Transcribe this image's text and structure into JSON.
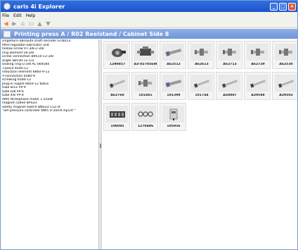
{
  "window": {
    "title": "caris 4i Explorer"
  },
  "menu": {
    "items": [
      "File",
      "Edit",
      "Help"
    ]
  },
  "toolbar": {
    "buttons": [
      "back-icon",
      "forward-icon",
      "home-icon",
      "page-icon",
      "up-icon",
      "down-icon"
    ]
  },
  "header": {
    "title": "Printing press A / R02 Reelstand / Cabinet Side 8"
  },
  "parts_list": {
    "items": [
      "singleturn-absolute shaft encoder ECN413",
      "filter-regulator-lubricator unit",
      "hollow screw VT-3/8-2-3/8",
      "ring element LK-3/8",
      "screw connection B9510-12-3/8",
      "angle SB530-12-1/2",
      "sealing ring G-3/8 AL SK9584",
      "T-piece 6540-12",
      "reduction element 6860-9-12",
      "Y-connection 6580-9",
      "screwing 6580-12",
      "plug-in nipple 6850-12  Bibus",
      "tube 8/12 PP-9",
      "tube 6/8 PP-6",
      "tube 4/6 PP-4",
      "AMV threephase motor 1.55kW",
      "magnet coded BPS33",
      "safety magnet switch BNS33-11Z-st",
      "\"SIP-pressure controller NW5 0-20mA  Rp1/4\"\""
    ]
  },
  "thumbnails": {
    "items": [
      {
        "label": "1290857",
        "part": "sensor"
      },
      {
        "label": "A3-02705EW",
        "part": "valve"
      },
      {
        "label": "A62512",
        "part": "pipe"
      },
      {
        "label": "A62613",
        "part": "fitting"
      },
      {
        "label": "A62713",
        "part": "fitting"
      },
      {
        "label": "A62729",
        "part": "fitting"
      },
      {
        "label": "A62530",
        "part": "fitting"
      },
      {
        "label": "A62768",
        "part": "tube"
      },
      {
        "label": "101481",
        "part": "fitting"
      },
      {
        "label": "101399",
        "part": "pipe"
      },
      {
        "label": "101744",
        "part": "tube"
      },
      {
        "label": "A38087",
        "part": "tube"
      },
      {
        "label": "A39588",
        "part": "tube"
      },
      {
        "label": "A39502",
        "part": "tube"
      },
      {
        "label": "109095",
        "part": "block"
      },
      {
        "label": "1270496",
        "part": "rings"
      },
      {
        "label": "105956",
        "part": "switch"
      }
    ]
  },
  "colors": {
    "titlebar": "#1f52c8",
    "header": "#7a9bd9",
    "toolbar_active": "#e18a1f"
  }
}
